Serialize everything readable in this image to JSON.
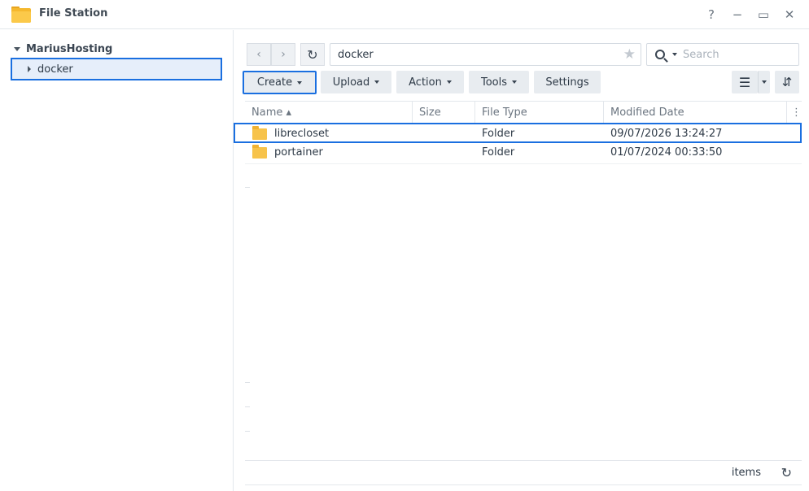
{
  "window": {
    "title": "File Station",
    "help_glyph": "?",
    "minimize_glyph": "−",
    "maximize_glyph": "▭",
    "close_glyph": "✕"
  },
  "sidebar": {
    "root_label": "MariusHosting",
    "items": [
      {
        "label": "docker"
      }
    ]
  },
  "toolbar": {
    "back_glyph": "‹",
    "forward_glyph": "›",
    "refresh_glyph": "↻",
    "path_value": "docker",
    "star_glyph": "★",
    "search_placeholder": "Search",
    "create_label": "Create",
    "upload_label": "Upload",
    "action_label": "Action",
    "tools_label": "Tools",
    "settings_label": "Settings",
    "list_view_glyph": "☰",
    "sort_glyph": "⇵"
  },
  "table": {
    "columns": {
      "name": "Name ▴",
      "size": "Size",
      "file_type": "File Type",
      "modified_date": "Modified Date",
      "more_glyph": "⋮"
    },
    "rows": [
      {
        "name": "librecloset",
        "size": "",
        "file_type": "Folder",
        "modified": "09/07/2026 13:24:27"
      },
      {
        "name": "portainer",
        "size": "",
        "file_type": "Folder",
        "modified": "01/07/2024 00:33:50"
      }
    ]
  },
  "footer": {
    "items_label": "items",
    "refresh_glyph": "↻"
  },
  "colors": {
    "accent_highlight": "#1a6fe0",
    "folder": "#f7c34b",
    "selected_bg": "#e6eefa"
  }
}
